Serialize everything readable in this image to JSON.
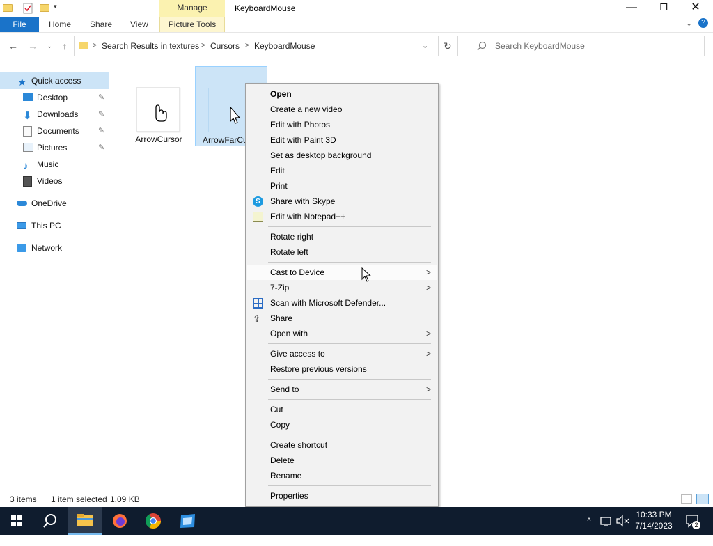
{
  "window": {
    "title": "KeyboardMouse",
    "contextual_tab_group": "Manage",
    "minimize_glyph": "—",
    "maximize_glyph": "❐",
    "close_glyph": "✕"
  },
  "ribbon": {
    "tabs": [
      "File",
      "Home",
      "Share",
      "View",
      "Picture Tools"
    ]
  },
  "address": {
    "crumbs": [
      "Search Results in textures",
      "Cursors",
      "KeyboardMouse"
    ],
    "search_placeholder": "Search KeyboardMouse"
  },
  "nav_pane": {
    "items": [
      {
        "label": "Quick access",
        "icon": "star-icon"
      },
      {
        "label": "Desktop",
        "icon": "desktop-icon",
        "pinned": true
      },
      {
        "label": "Downloads",
        "icon": "download-icon",
        "pinned": true
      },
      {
        "label": "Documents",
        "icon": "documents-icon",
        "pinned": true
      },
      {
        "label": "Pictures",
        "icon": "pictures-icon",
        "pinned": true
      },
      {
        "label": "Music",
        "icon": "music-icon"
      },
      {
        "label": "Videos",
        "icon": "videos-icon"
      },
      {
        "label": "OneDrive",
        "icon": "cloud-icon"
      },
      {
        "label": "This PC",
        "icon": "computer-icon"
      },
      {
        "label": "Network",
        "icon": "network-icon"
      }
    ]
  },
  "files": [
    {
      "name": "ArrowCursor",
      "selected": false,
      "icon": "hand-cursor-icon"
    },
    {
      "name": "ArrowFarCu",
      "selected": true,
      "icon": "arrow-cursor-icon"
    }
  ],
  "status": {
    "item_count": "3 items",
    "selection": "1 item selected",
    "size": "1.09 KB"
  },
  "context_menu": {
    "groups": [
      [
        {
          "label": "Open",
          "bold": true
        },
        {
          "label": "Create a new video"
        },
        {
          "label": "Edit with Photos"
        },
        {
          "label": "Edit with Paint 3D"
        },
        {
          "label": "Set as desktop background"
        },
        {
          "label": "Edit"
        },
        {
          "label": "Print"
        },
        {
          "label": "Share with Skype",
          "icon": "skype-icon"
        },
        {
          "label": "Edit with Notepad++",
          "icon": "notepadpp-icon"
        }
      ],
      [
        {
          "label": "Rotate right"
        },
        {
          "label": "Rotate left"
        }
      ],
      [
        {
          "label": "Cast to Device",
          "submenu": true,
          "highlighted": true
        },
        {
          "label": "7-Zip",
          "submenu": true
        },
        {
          "label": "Scan with Microsoft Defender...",
          "icon": "defender-icon"
        },
        {
          "label": "Share",
          "icon": "share-icon"
        },
        {
          "label": "Open with",
          "submenu": true
        }
      ],
      [
        {
          "label": "Give access to",
          "submenu": true
        },
        {
          "label": "Restore previous versions"
        }
      ],
      [
        {
          "label": "Send to",
          "submenu": true
        }
      ],
      [
        {
          "label": "Cut"
        },
        {
          "label": "Copy"
        }
      ],
      [
        {
          "label": "Create shortcut"
        },
        {
          "label": "Delete"
        },
        {
          "label": "Rename"
        }
      ],
      [
        {
          "label": "Properties"
        }
      ]
    ]
  },
  "taskbar": {
    "time": "10:33 PM",
    "date": "7/14/2023",
    "notification_count": "2"
  },
  "colors": {
    "file_tab": "#1a73c9",
    "selection": "#cce4f7",
    "taskbar": "#0f1c2e",
    "manage_tab": "#fbf2b0"
  }
}
